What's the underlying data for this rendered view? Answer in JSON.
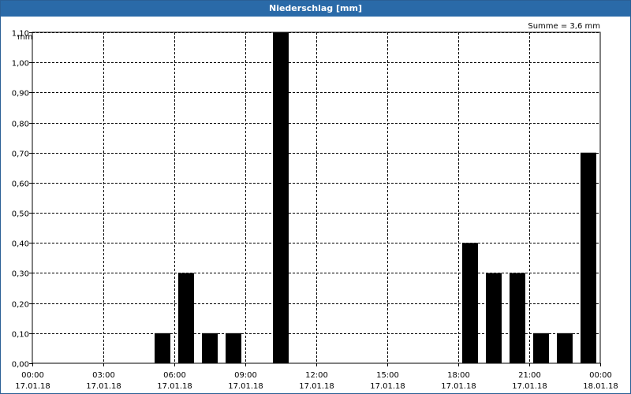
{
  "window": {
    "title": "Niederschlag [mm]"
  },
  "chart_data": {
    "type": "bar",
    "title": "Niederschlag [mm]",
    "ylabel": "mm",
    "xlabel": "",
    "annotation": "Summe = 3,6 mm",
    "ylim": [
      0,
      1.1
    ],
    "yticks": [
      "0,00",
      "0,10",
      "0,20",
      "0,30",
      "0,40",
      "0,50",
      "0,60",
      "0,70",
      "0,80",
      "0,90",
      "1,00",
      "1,10"
    ],
    "xticks": [
      {
        "time": "00:00",
        "date": "17.01.18"
      },
      {
        "time": "03:00",
        "date": "17.01.18"
      },
      {
        "time": "06:00",
        "date": "17.01.18"
      },
      {
        "time": "09:00",
        "date": "17.01.18"
      },
      {
        "time": "12:00",
        "date": "17.01.18"
      },
      {
        "time": "15:00",
        "date": "17.01.18"
      },
      {
        "time": "18:00",
        "date": "17.01.18"
      },
      {
        "time": "21:00",
        "date": "17.01.18"
      },
      {
        "time": "00:00",
        "date": "18.01.18"
      }
    ],
    "x_hours_range": [
      0,
      24
    ],
    "bars": [
      {
        "hour": 6,
        "value": 0.1
      },
      {
        "hour": 7,
        "value": 0.3
      },
      {
        "hour": 8,
        "value": 0.1
      },
      {
        "hour": 9,
        "value": 0.1
      },
      {
        "hour": 11,
        "value": 1.1
      },
      {
        "hour": 19,
        "value": 0.4
      },
      {
        "hour": 20,
        "value": 0.3
      },
      {
        "hour": 21,
        "value": 0.3
      },
      {
        "hour": 22,
        "value": 0.1
      },
      {
        "hour": 23,
        "value": 0.1
      },
      {
        "hour": 24,
        "value": 0.7
      }
    ],
    "grid": true,
    "bar_color": "#000000",
    "grid_color": "#000000"
  }
}
